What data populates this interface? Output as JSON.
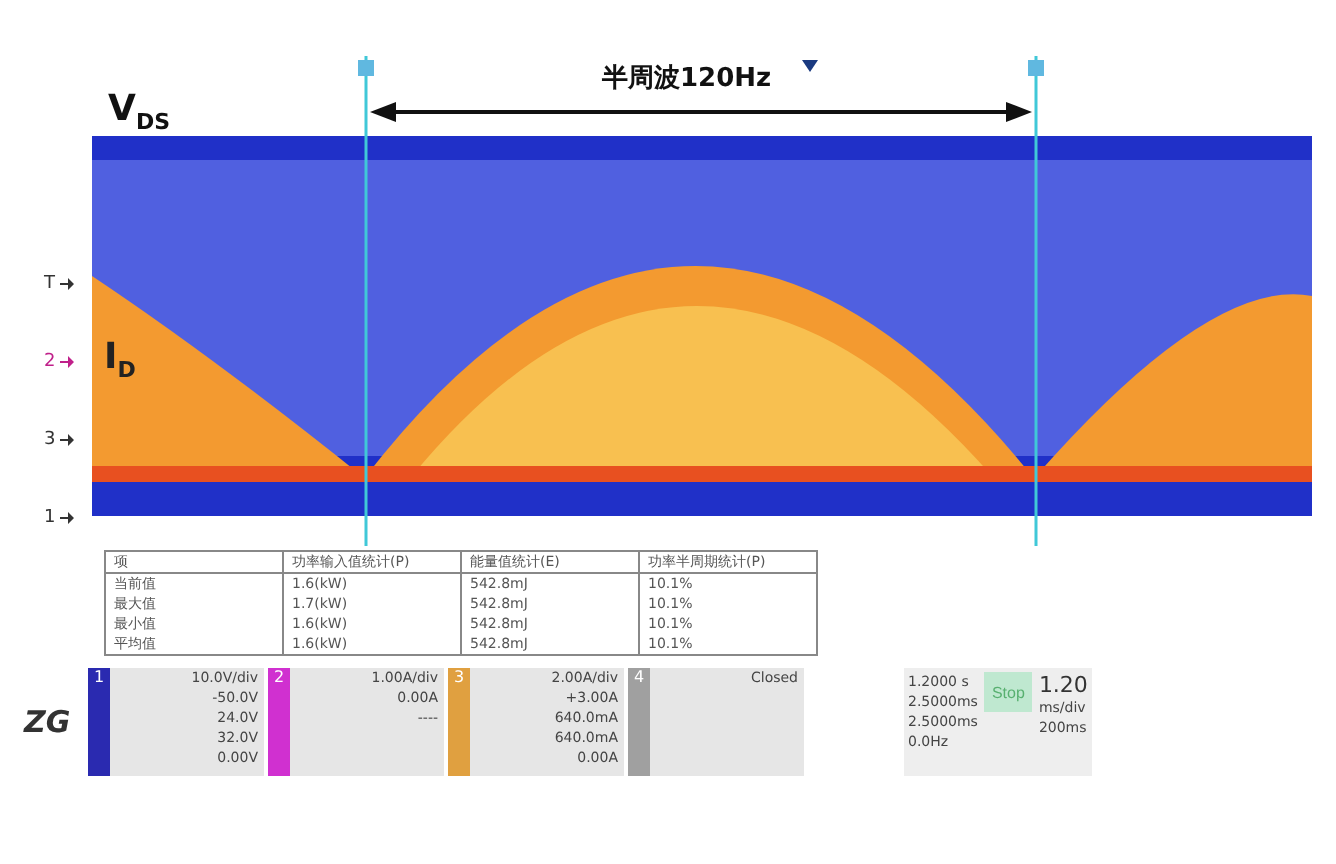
{
  "waveform": {
    "vds_label": "V",
    "vds_sub": "DS",
    "id_label": "I",
    "id_sub": "D",
    "span_label": "半周波120Hz",
    "channel_markers": [
      {
        "label": "T",
        "color": "#333333"
      },
      {
        "label": "2",
        "color": "#c0208a"
      },
      {
        "label": "3",
        "color": "#333333"
      },
      {
        "label": "1",
        "color": "#333333"
      }
    ]
  },
  "table": {
    "columns": [
      "项",
      "功率输入值统计(P)",
      "能量值统计(E)",
      "功率半周期统计(P)"
    ],
    "rows": [
      [
        "当前值",
        "1.6(kW)",
        "542.8mJ",
        "10.1%"
      ],
      [
        "最大值",
        "1.7(kW)",
        "542.8mJ",
        "10.1%"
      ],
      [
        "最小值",
        "1.6(kW)",
        "542.8mJ",
        "10.1%"
      ],
      [
        "平均值",
        "1.6(kW)",
        "542.8mJ",
        "10.1%"
      ]
    ]
  },
  "channels": [
    {
      "num": "1",
      "color": "#2a2ab0",
      "scale": "10.0V/div",
      "offset": "-50.0V",
      "row2": "24.0V",
      "row3": "32.0V",
      "row4": "0.00V"
    },
    {
      "num": "2",
      "color": "#d030d0",
      "scale": "1.00A/div",
      "offset": "0.00A",
      "row3": "----"
    },
    {
      "num": "3",
      "color": "#e0a040",
      "scale": "2.00A/div",
      "offset": "+3.00A",
      "row2": "640.0mA",
      "row3": "640.0mA",
      "row4": "0.00A"
    },
    {
      "num": "4",
      "color": "#a0a0a0",
      "scale": "Closed"
    }
  ],
  "logo": "ZG",
  "timebase": {
    "rows": [
      "1.2000 s",
      "2.5000ms",
      "2.5000ms",
      "0.0Hz"
    ],
    "run_state": "Stop",
    "scale": "1.20",
    "scale_unit": "ms/div",
    "trig": "200ms"
  }
}
